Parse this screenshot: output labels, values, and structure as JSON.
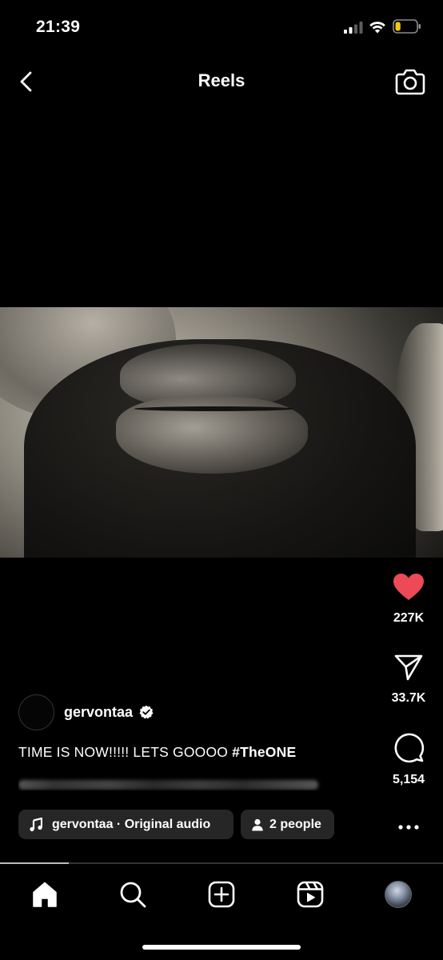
{
  "status_bar": {
    "time": "21:39",
    "signal_bars_active": 2,
    "signal_bars_total": 4,
    "battery_level_percent": 25,
    "battery_color": "#f5c518"
  },
  "header": {
    "title": "Reels",
    "back_icon": "chevron-left-icon",
    "camera_icon": "camera-icon"
  },
  "actions": {
    "like_count": "227K",
    "like_color": "#ed4956",
    "share_count": "33.7K",
    "comment_count": "5,154"
  },
  "post": {
    "username": "gervontaa",
    "verified": true,
    "caption_text": "TIME IS NOW!!!!! LETS GOOOO ",
    "caption_hashtag": "#TheONE"
  },
  "audio": {
    "label": "gervontaa · Original audio"
  },
  "people": {
    "label": "2 people"
  },
  "video_progress_fraction": 0.155,
  "nav": {
    "items": [
      "home-icon",
      "search-icon",
      "create-icon",
      "reels-icon",
      "profile-avatar"
    ],
    "active": "home-icon"
  }
}
